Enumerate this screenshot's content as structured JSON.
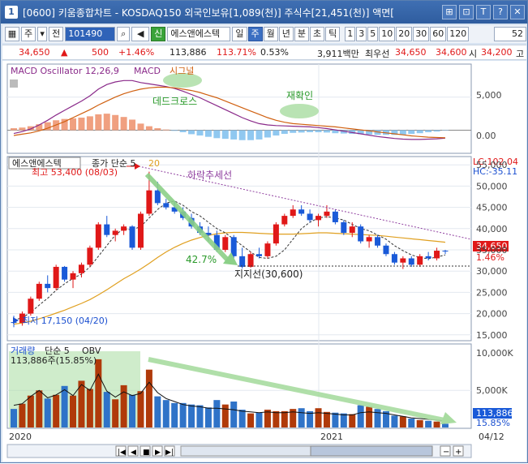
{
  "window": {
    "icon_label": "1",
    "title": "[0600] 키움종합차트 - KOSDAQ150 외국인보유[1,089(천)] 주식수[21,451(천)] 액면[",
    "buttons": [
      "⊞",
      "⊡",
      "T",
      "?",
      "✕"
    ]
  },
  "toolbar": {
    "grid_icon": "▦",
    "market": "주",
    "market_arrow": "▾",
    "prev": "전",
    "code": "101490",
    "search_icon": "⌕",
    "speaker_icon": "◀",
    "new_btn": "신",
    "stock_name": "에스앤에스텍",
    "periods": [
      "일",
      "주",
      "월",
      "년",
      "분",
      "초",
      "틱"
    ],
    "active_period": "주",
    "intervals": [
      "1",
      "3",
      "5",
      "10",
      "20",
      "30",
      "60",
      "120"
    ],
    "count": "52"
  },
  "pricebar": {
    "price": "34,650",
    "change": "500",
    "change_pct": "+1.46%",
    "volume": "113,886",
    "vol_ratio": "113.71%",
    "turnover": "0.53%",
    "amount": "3,911백만",
    "best_ask_label": "최우선",
    "best_ask": "34,650",
    "best_bid": "34,600",
    "open_label": "시",
    "open": "34,200",
    "high_label": "고"
  },
  "macd": {
    "title": "MACD Oscillator 12,26,9",
    "macd_label": "MACD",
    "signal_label": "시그널",
    "annotation_dead": "데드크로스",
    "annotation_confirm": "재확인",
    "y_ticks": [
      "5,000",
      "0.00"
    ]
  },
  "price": {
    "title": "에스앤에스텍",
    "ma_label": "종가 단순 5",
    "ma2_label": "20",
    "high_note": "최고 53,400 (08/03)",
    "low_note": "최저 17,150 (04/20)",
    "trend_label": "하락추세선",
    "pct_label": "42.7%",
    "support_label": "지지선(30,600)",
    "lc": "LC:102.04",
    "hc": "HC:-35.11",
    "last_price_tag": "34,650",
    "last_pct_tag": "1.46%",
    "y_ticks": [
      "55,000",
      "50,000",
      "45,000",
      "40,000",
      "35,000",
      "30,000",
      "25,000",
      "20,000",
      "15,000"
    ]
  },
  "volume": {
    "title": "거래량",
    "ma_label": "단순 5",
    "obv_label": "OBV",
    "vol_note": "113,886주(15.85%)",
    "last_vol_tag": "113,886",
    "last_pct_tag": "15.85%",
    "y_ticks": [
      "10,000K",
      "5,000K"
    ]
  },
  "xaxis": {
    "labels": [
      "2020",
      "2021",
      "04/12"
    ]
  },
  "colors": {
    "up": "#e01818",
    "down": "#1a5ad8",
    "vol_up": "#b03a0a",
    "vol_down": "#2f73c8",
    "ma5": "#333333",
    "ma20": "#e0a020",
    "macd": "#8a2a8a",
    "signal": "#d06010",
    "osc_pos": "#f0a080",
    "osc_neg": "#90c8f0",
    "annotation_green": "#3aa33a"
  },
  "chart_data": {
    "type": "candlestick",
    "xlabel": "",
    "ylabel": "",
    "ylim": [
      14000,
      56000
    ],
    "candles": [
      {
        "o": 18000,
        "h": 19500,
        "l": 16800,
        "c": 17800
      },
      {
        "o": 17800,
        "h": 20500,
        "l": 17150,
        "c": 20000
      },
      {
        "o": 20000,
        "h": 24000,
        "l": 19500,
        "c": 23500
      },
      {
        "o": 23500,
        "h": 27500,
        "l": 23000,
        "c": 27000
      },
      {
        "o": 27000,
        "h": 29000,
        "l": 25000,
        "c": 26000
      },
      {
        "o": 26000,
        "h": 31500,
        "l": 25500,
        "c": 31000
      },
      {
        "o": 31000,
        "h": 31200,
        "l": 27500,
        "c": 28000
      },
      {
        "o": 28000,
        "h": 30000,
        "l": 26000,
        "c": 29500
      },
      {
        "o": 29500,
        "h": 32000,
        "l": 28500,
        "c": 31500
      },
      {
        "o": 31500,
        "h": 36000,
        "l": 31000,
        "c": 35500
      },
      {
        "o": 35500,
        "h": 41500,
        "l": 35000,
        "c": 41000
      },
      {
        "o": 41000,
        "h": 43000,
        "l": 38000,
        "c": 38500
      },
      {
        "o": 38500,
        "h": 40000,
        "l": 37000,
        "c": 39500
      },
      {
        "o": 39500,
        "h": 41000,
        "l": 38500,
        "c": 40500
      },
      {
        "o": 40500,
        "h": 40800,
        "l": 35000,
        "c": 35500
      },
      {
        "o": 35500,
        "h": 44000,
        "l": 35000,
        "c": 43500
      },
      {
        "o": 43500,
        "h": 53400,
        "l": 43000,
        "c": 49000
      },
      {
        "o": 49000,
        "h": 51000,
        "l": 45500,
        "c": 46000
      },
      {
        "o": 46000,
        "h": 47000,
        "l": 44500,
        "c": 45000
      },
      {
        "o": 45000,
        "h": 46500,
        "l": 43500,
        "c": 44000
      },
      {
        "o": 44000,
        "h": 45000,
        "l": 42000,
        "c": 42500
      },
      {
        "o": 42500,
        "h": 43500,
        "l": 40000,
        "c": 40500
      },
      {
        "o": 40500,
        "h": 41500,
        "l": 38500,
        "c": 39000
      },
      {
        "o": 39000,
        "h": 40500,
        "l": 37000,
        "c": 38500
      },
      {
        "o": 38500,
        "h": 39500,
        "l": 34500,
        "c": 35000
      },
      {
        "o": 35000,
        "h": 38500,
        "l": 34500,
        "c": 38000
      },
      {
        "o": 38000,
        "h": 38500,
        "l": 33000,
        "c": 33500
      },
      {
        "o": 33500,
        "h": 35500,
        "l": 30600,
        "c": 31000
      },
      {
        "o": 31000,
        "h": 34500,
        "l": 30800,
        "c": 34000
      },
      {
        "o": 34000,
        "h": 35500,
        "l": 33000,
        "c": 33500
      },
      {
        "o": 33500,
        "h": 37000,
        "l": 33000,
        "c": 36500
      },
      {
        "o": 36500,
        "h": 41500,
        "l": 36000,
        "c": 41000
      },
      {
        "o": 41000,
        "h": 43500,
        "l": 40500,
        "c": 43000
      },
      {
        "o": 43000,
        "h": 45500,
        "l": 42500,
        "c": 44500
      },
      {
        "o": 44500,
        "h": 45500,
        "l": 43000,
        "c": 43500
      },
      {
        "o": 43500,
        "h": 44500,
        "l": 41500,
        "c": 42000
      },
      {
        "o": 42000,
        "h": 43500,
        "l": 40500,
        "c": 43000
      },
      {
        "o": 43000,
        "h": 45500,
        "l": 42500,
        "c": 44000
      },
      {
        "o": 44000,
        "h": 44500,
        "l": 41000,
        "c": 41500
      },
      {
        "o": 41500,
        "h": 42000,
        "l": 38500,
        "c": 39000
      },
      {
        "o": 39000,
        "h": 41500,
        "l": 38000,
        "c": 40500
      },
      {
        "o": 40500,
        "h": 41000,
        "l": 36500,
        "c": 37000
      },
      {
        "o": 37000,
        "h": 38500,
        "l": 35500,
        "c": 38000
      },
      {
        "o": 38000,
        "h": 38500,
        "l": 35500,
        "c": 36000
      },
      {
        "o": 36000,
        "h": 36500,
        "l": 33500,
        "c": 34000
      },
      {
        "o": 34000,
        "h": 34500,
        "l": 31500,
        "c": 32000
      },
      {
        "o": 32000,
        "h": 33500,
        "l": 30500,
        "c": 33000
      },
      {
        "o": 33000,
        "h": 33500,
        "l": 31000,
        "c": 31500
      },
      {
        "o": 31500,
        "h": 34000,
        "l": 31000,
        "c": 33500
      },
      {
        "o": 33500,
        "h": 34500,
        "l": 32500,
        "c": 33000
      },
      {
        "o": 33000,
        "h": 35500,
        "l": 32500,
        "c": 34800
      },
      {
        "o": 34800,
        "h": 35000,
        "l": 34000,
        "c": 34650
      }
    ],
    "volume": [
      2500,
      3200,
      4300,
      5000,
      3900,
      4400,
      5600,
      4300,
      6300,
      5200,
      9200,
      4800,
      3800,
      5700,
      4400,
      4900,
      7800,
      4200,
      3700,
      3300,
      3300,
      3100,
      3000,
      2700,
      3700,
      3100,
      3500,
      2400,
      1900,
      2000,
      2400,
      2200,
      2200,
      2500,
      2600,
      2200,
      2600,
      2100,
      2000,
      1900,
      1800,
      3000,
      2800,
      2500,
      2200,
      1600,
      1500,
      1200,
      1000,
      900,
      800,
      500
    ],
    "obv": [
      3000,
      3200,
      4200,
      5000,
      4000,
      4400,
      5100,
      4300,
      5800,
      5000,
      7200,
      4900,
      4100,
      4800,
      4300,
      4600,
      6100,
      4700,
      3900,
      3500,
      3100,
      2900,
      2800,
      2600,
      2600,
      2500,
      2400,
      2200,
      2100,
      2000,
      2100,
      2000,
      2000,
      2100,
      2000,
      1900,
      2000,
      1900,
      1800,
      1700,
      1700,
      2000,
      2100,
      2000,
      1900,
      1700,
      1500,
      1300,
      1200,
      1100,
      1000,
      900
    ],
    "macd": [
      -500,
      -200,
      200,
      800,
      1500,
      2300,
      3000,
      3700,
      4400,
      5200,
      6200,
      6900,
      7300,
      7500,
      7500,
      7200,
      7000,
      6800,
      6600,
      6300,
      5900,
      5400,
      4900,
      4300,
      3700,
      3100,
      2500,
      1900,
      1400,
      1000,
      800,
      700,
      650,
      600,
      550,
      500,
      400,
      250,
      50,
      -150,
      -350,
      -550,
      -750,
      -950,
      -1100,
      -1250,
      -1350,
      -1400,
      -1400,
      -1350,
      -1300,
      -1200
    ],
    "signal": [
      -800,
      -600,
      -400,
      -100,
      300,
      800,
      1300,
      1900,
      2500,
      3100,
      3800,
      4400,
      5000,
      5500,
      5900,
      6200,
      6400,
      6500,
      6500,
      6400,
      6200,
      6000,
      5700,
      5300,
      4900,
      4400,
      3900,
      3400,
      2900,
      2400,
      1900,
      1500,
      1200,
      1000,
      900,
      800,
      700,
      600,
      500,
      350,
      200,
      50,
      -100,
      -250,
      -400,
      -550,
      -700,
      -850,
      -950,
      -1050,
      -1100,
      -1150
    ],
    "ma5": [
      18500,
      19000,
      20300,
      22000,
      23600,
      25500,
      27000,
      28300,
      29300,
      31000,
      33500,
      36000,
      38500,
      40000,
      39700,
      40500,
      42500,
      44500,
      46000,
      46500,
      45500,
      44000,
      43000,
      41500,
      40000,
      39000,
      37500,
      36000,
      34500,
      33200,
      33000,
      33500,
      35000,
      37500,
      40000,
      41500,
      42500,
      42800,
      42500,
      42000,
      41000,
      40000,
      39500,
      38500,
      37500,
      36000,
      34800,
      33800,
      33200,
      32900,
      33300,
      33800
    ],
    "ma20": [
      17500,
      17800,
      18200,
      18800,
      19400,
      20100,
      20800,
      21600,
      22400,
      23300,
      24400,
      25600,
      26900,
      28200,
      29300,
      30500,
      31800,
      33200,
      34500,
      35600,
      36500,
      37300,
      37900,
      38400,
      38800,
      39000,
      39100,
      39100,
      39000,
      38900,
      38800,
      38700,
      38700,
      38700,
      38800,
      38900,
      39000,
      39000,
      38900,
      38800,
      38700,
      38600,
      38500,
      38400,
      38200,
      38000,
      37800,
      37600,
      37400,
      37200,
      37000,
      36800
    ]
  }
}
